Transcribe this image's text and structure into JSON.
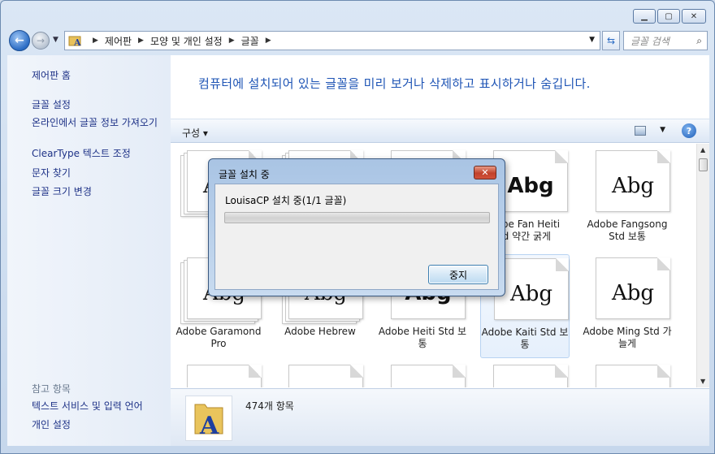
{
  "window": {
    "minimize_icon": "minimize-icon",
    "maximize_icon": "maximize-icon",
    "close_icon": "close-icon"
  },
  "address_bar": {
    "crumbs": [
      "제어판",
      "모양 및 개인 설정",
      "글꼴"
    ],
    "search_placeholder": "글꼴 검색"
  },
  "sidebar": {
    "home": "제어판 홈",
    "links": [
      "글꼴 설정",
      "온라인에서 글꼴 정보 가져오기",
      "ClearType 텍스트 조정",
      "문자 찾기",
      "글꼴 크기 변경"
    ],
    "see_also_title": "참고 항목",
    "see_also": [
      "텍스트 서비스 및 입력 언어",
      "개인 설정"
    ]
  },
  "main": {
    "headline": "컴퓨터에 설치되어 있는 글꼴을 미리 보거나 삭제하고 표시하거나 숨깁니다.",
    "organize": "구성",
    "fonts": [
      {
        "sample": "Abg",
        "name": "Adobe Arabic",
        "visible_name": "Ado",
        "style": "serif",
        "stacked": true
      },
      {
        "sample": "Abg",
        "name": "",
        "style": "serif",
        "stacked": true
      },
      {
        "sample": "Abg",
        "name": "",
        "style": "bold",
        "stacked": false
      },
      {
        "sample": "Abg",
        "name": "Adobe Fan Heiti Std 약간 굵게",
        "visible_name": "dobe Fan Heiti\ntd 약간 굵게",
        "style": "bold",
        "stacked": false
      },
      {
        "sample": "Abg",
        "name": "Adobe Fangsong Std 보통",
        "style": "serif",
        "stacked": false
      },
      {
        "sample": "Abg",
        "name": "Adobe Garamond Pro",
        "style": "serif",
        "stacked": true
      },
      {
        "sample": "Abg",
        "name": "Adobe Hebrew",
        "style": "serif",
        "stacked": true
      },
      {
        "sample": "Abg",
        "name": "Adobe Heiti Std 보통",
        "style": "bold",
        "stacked": false
      },
      {
        "sample": "Abg",
        "name": "Adobe Kaiti Std 보통",
        "style": "serif",
        "stacked": false,
        "selected": true
      },
      {
        "sample": "Abg",
        "name": "Adobe Ming Std 가늘게",
        "style": "serif",
        "stacked": false
      }
    ],
    "item_count": "474개 항목"
  },
  "dialog": {
    "title": "글꼴 설치 중",
    "message": "LouisaCP 설치 중(1/1 글꼴)",
    "progress": 0,
    "stop": "중지"
  }
}
